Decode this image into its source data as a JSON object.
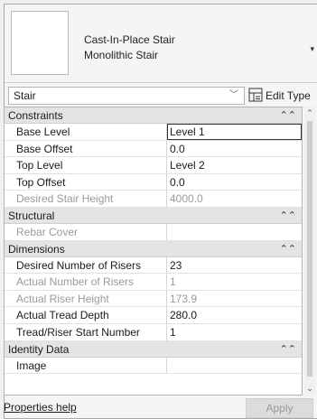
{
  "type_selector": {
    "family": "Cast-In-Place Stair",
    "type": "Monolithic Stair"
  },
  "instance_filter": {
    "value": "Stair",
    "edit_type_label": "Edit Type"
  },
  "groups": [
    {
      "title": "Constraints",
      "rows": [
        {
          "name": "Base Level",
          "value": "Level 1",
          "readonly": false,
          "editing": true
        },
        {
          "name": "Base Offset",
          "value": "0.0",
          "readonly": false
        },
        {
          "name": "Top Level",
          "value": "Level 2",
          "readonly": false
        },
        {
          "name": "Top Offset",
          "value": "0.0",
          "readonly": false
        },
        {
          "name": "Desired Stair Height",
          "value": "4000.0",
          "readonly": true
        }
      ]
    },
    {
      "title": "Structural",
      "rows": [
        {
          "name": "Rebar Cover",
          "value": "",
          "readonly": true
        }
      ]
    },
    {
      "title": "Dimensions",
      "rows": [
        {
          "name": "Desired Number of Risers",
          "value": "23",
          "readonly": false
        },
        {
          "name": "Actual Number of Risers",
          "value": "1",
          "readonly": true
        },
        {
          "name": "Actual Riser Height",
          "value": "173.9",
          "readonly": true
        },
        {
          "name": "Actual Tread Depth",
          "value": "280.0",
          "readonly": false
        },
        {
          "name": "Tread/Riser Start Number",
          "value": "1",
          "readonly": false
        }
      ]
    },
    {
      "title": "Identity Data",
      "rows": [
        {
          "name": "Image",
          "value": "",
          "readonly": false
        }
      ]
    }
  ],
  "footer": {
    "help_link": "Properties help",
    "apply_label": "Apply"
  },
  "icons": {
    "collapse": "double-chevron-up-icon",
    "dropdown": "chevron-down-icon",
    "edit_type": "edit-type-icon"
  }
}
